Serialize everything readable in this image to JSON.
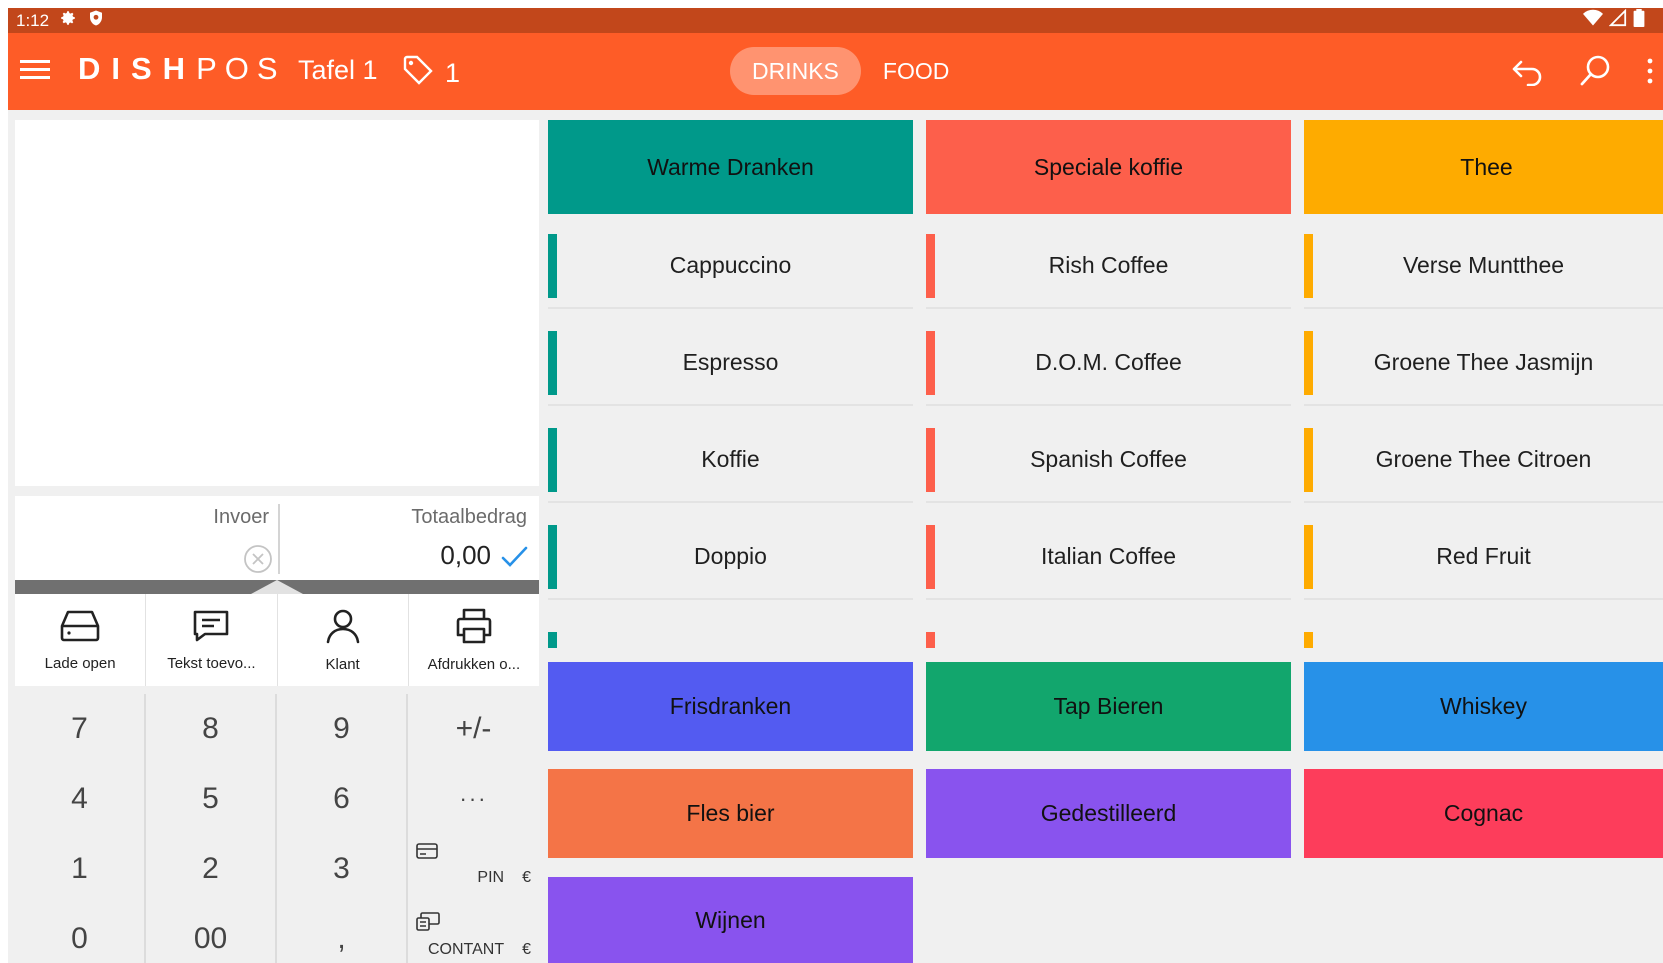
{
  "status_bar": {
    "time": "1:12",
    "icons": [
      "gear-icon",
      "shield-icon",
      "wifi-icon",
      "signal-icon",
      "battery-icon"
    ]
  },
  "app_bar": {
    "brand_bold": "DISH",
    "brand_light": "POS",
    "table": "Tafel 1",
    "guest_count": "1",
    "tabs": [
      {
        "label": "DRINKS",
        "active": true
      },
      {
        "label": "FOOD",
        "active": false
      }
    ],
    "background": "#fe5c27",
    "active_tab_color": "#ff9370"
  },
  "totals": {
    "invoer_label": "Invoer",
    "totaal_label": "Totaalbedrag",
    "amount": "0,00"
  },
  "tools": [
    {
      "label": "Lade open",
      "icon": "drawer-icon"
    },
    {
      "label": "Tekst toevo...",
      "icon": "message-icon"
    },
    {
      "label": "Klant",
      "icon": "user-icon"
    },
    {
      "label": "Afdrukken o...",
      "icon": "printer-icon"
    }
  ],
  "keypad": {
    "keys": [
      "7",
      "8",
      "9",
      "+/-",
      "4",
      "5",
      "6",
      "···",
      "1",
      "2",
      "3",
      "0",
      "00",
      ","
    ],
    "pin_label": "PIN",
    "contant_label": "CONTANT",
    "currency": "€"
  },
  "categories_top": [
    {
      "label": "Warme Dranken",
      "color": "#00998a"
    },
    {
      "label": "Speciale koffie",
      "color": "#fd5f4b"
    },
    {
      "label": "Thee",
      "color": "#feab00"
    }
  ],
  "items": [
    [
      "Cappuccino",
      "Espresso",
      "Koffie",
      "Doppio"
    ],
    [
      "Rish Coffee",
      "D.O.M. Coffee",
      "Spanish Coffee",
      "Italian Coffee"
    ],
    [
      "Verse Muntthee",
      "Groene Thee Jasmijn",
      "Groene Thee Citroen",
      "Red Fruit"
    ]
  ],
  "categories_bottom": [
    {
      "label": "Frisdranken",
      "color": "#535bf1"
    },
    {
      "label": "Tap Bieren",
      "color": "#12a66d"
    },
    {
      "label": "Whiskey",
      "color": "#2791e8"
    },
    {
      "label": "Fles bier",
      "color": "#f47447"
    },
    {
      "label": "Gedestilleerd",
      "color": "#8953ee"
    },
    {
      "label": "Cognac",
      "color": "#fd3d5b"
    },
    {
      "label": "Wijnen",
      "color": "#8953ee"
    }
  ]
}
